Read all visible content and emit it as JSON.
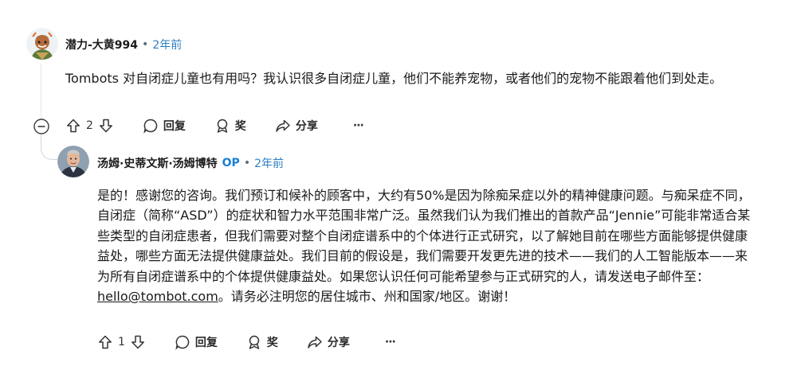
{
  "comment1": {
    "username": "潜力-大黄994",
    "separator": "•",
    "time": "2年前",
    "body": "Tombots 对自闭症儿童也有用吗？我认识很多自闭症儿童，他们不能养宠物，或者他们的宠物不能跟着他们到处走。",
    "vote_count": "2",
    "reply_label": "回复",
    "award_label": "奖",
    "share_label": "分享",
    "more_label": "···"
  },
  "comment2": {
    "username": "汤姆·史蒂文斯·汤姆博特",
    "op_badge": "OP",
    "separator": "•",
    "time": "2年前",
    "body_before_email": "是的！感谢您的咨询。我们预订和候补的顾客中，大约有50%是因为除痴呆症以外的精神健康问题。与痴呆症不同，自闭症（简称“ASD”）的症状和智力水平范围非常广泛。虽然我们认为我们推出的首款产品“Jennie”可能非常适合某些类型的自闭症患者，但我们需要对整个自闭症谱系中的个体进行正式研究，以了解她目前在哪些方面能够提供健康益处，哪些方面无法提供健康益处。我们目前的假设是，我们需要开发更先进的技术——我们的人工智能版本——来为所有自闭症谱系中的个体提供健康益处。如果您认识任何可能希望参与正式研究的人，请发送电子邮件至：",
    "email": "hello@tombot.com",
    "body_after_email": "。请务必注明您的居住城市、州和国家/地区。谢谢！",
    "vote_count": "1",
    "reply_label": "回复",
    "award_label": "奖",
    "share_label": "分享",
    "more_label": "···"
  },
  "colors": {
    "time_link": "#2f7fc1",
    "op_badge": "#1a7fd4",
    "thread_line": "#e5e7eb"
  },
  "icons": [
    "upvote-icon",
    "downvote-icon",
    "comment-icon",
    "award-icon",
    "share-icon",
    "more-icon",
    "collapse-icon"
  ]
}
